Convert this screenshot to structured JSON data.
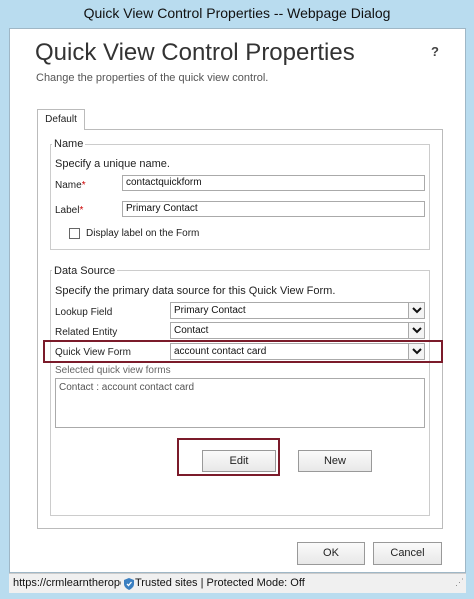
{
  "window": {
    "title": "Quick View Control Properties -- Webpage Dialog"
  },
  "header": {
    "title": "Quick View Control Properties",
    "subtitle": "Change the properties of the quick view control.",
    "help": "?"
  },
  "tabs": [
    {
      "label": "Default"
    }
  ],
  "name_section": {
    "title": "Name",
    "instruction": "Specify a unique name.",
    "name_label": "Name",
    "name_value": "contactquickform",
    "label_label": "Label",
    "label_value": "Primary Contact",
    "required_mark": "*",
    "display_label_checkbox": "Display label on the Form"
  },
  "data_source": {
    "title": "Data Source",
    "instruction": "Specify the primary data source for this Quick View Form.",
    "lookup_field_label": "Lookup Field",
    "lookup_field_value": "Primary Contact",
    "related_entity_label": "Related Entity",
    "related_entity_value": "Contact",
    "quick_view_form_label": "Quick View Form",
    "quick_view_form_value": "account contact card",
    "selected_label": "Selected quick view forms",
    "selected_items": [
      "Contact : account contact card"
    ],
    "edit_label": "Edit",
    "new_label": "New"
  },
  "footer": {
    "ok_label": "OK",
    "cancel_label": "Cancel"
  },
  "status_bar": {
    "url": "https://crmlearntherope",
    "zone": "Trusted sites | Protected Mode: Off"
  }
}
